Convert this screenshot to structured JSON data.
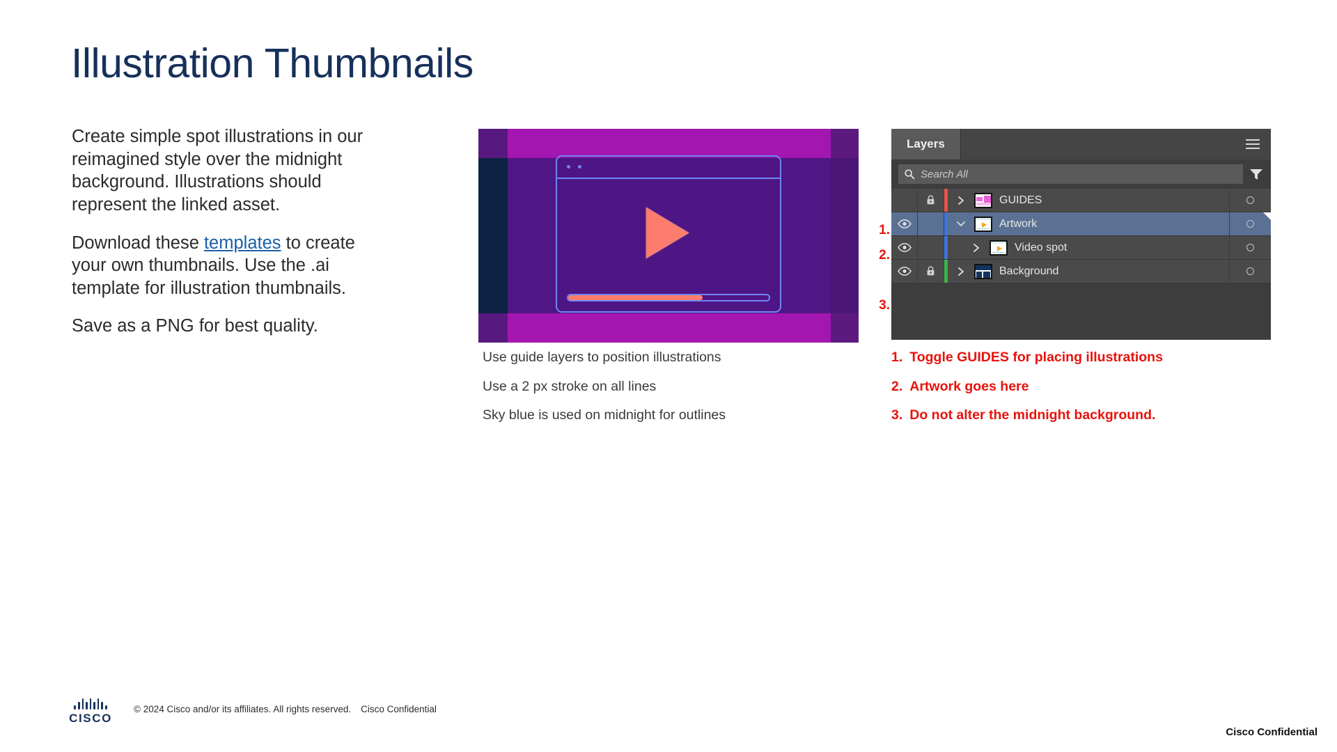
{
  "slide": {
    "title": "Illustration Thumbnails"
  },
  "copy": {
    "paragraph_1": "Create simple spot illustrations in our reimagined style over the midnight background. Illustrations should represent the linked asset.",
    "paragraph_2_before": "Download these ",
    "paragraph_2_link": "templates",
    "paragraph_2_after": " to create your own thumbnails. Use the .ai template for illustration thumbnails.",
    "paragraph_3": "Save as a PNG for best quality."
  },
  "thumbnail": {
    "alt": "video spot illustration on midnight background",
    "colors": {
      "magenta_band": "#a316b0",
      "purple_bg": "#4e1785",
      "navy_block": "#0e2243",
      "sky_blue_stroke": "#6f87f5",
      "coral": "#fc7d6e"
    },
    "captions": [
      "Use guide layers to position illustrations",
      "Use a 2 px stroke on all lines",
      "Sky blue is used on midnight for outlines"
    ]
  },
  "layers_panel": {
    "tab_label": "Layers",
    "menu_icon": "hamburger-icon",
    "search": {
      "placeholder": "Search All",
      "value": "",
      "icon": "search-icon",
      "filter_icon": "filter-icon"
    },
    "rows": [
      {
        "name": "GUIDES",
        "visible": false,
        "locked": true,
        "expanded": false,
        "selected": false,
        "indented": false,
        "color": "#e8544a",
        "thumb": "guides",
        "target_icon": "target-circle-icon"
      },
      {
        "name": "Artwork",
        "visible": true,
        "locked": false,
        "expanded": true,
        "selected": true,
        "indented": false,
        "color": "#3f74e0",
        "thumb": "artwork",
        "target_icon": "target-circle-icon"
      },
      {
        "name": "Video spot",
        "visible": true,
        "locked": false,
        "expanded": false,
        "selected": false,
        "indented": true,
        "color": "#3f74e0",
        "thumb": "artwork",
        "target_icon": "target-circle-icon"
      },
      {
        "name": "Background",
        "visible": true,
        "locked": true,
        "expanded": false,
        "selected": false,
        "indented": false,
        "color": "#3cb44a",
        "thumb": "background",
        "target_icon": "target-circle-icon"
      }
    ]
  },
  "callouts": {
    "numbers": [
      "1.",
      "2.",
      "3."
    ],
    "notes": [
      {
        "num": "1.",
        "text": "Toggle GUIDES for placing illustrations"
      },
      {
        "num": "2.",
        "text": "Artwork goes here"
      },
      {
        "num": "3.",
        "text": "Do not alter the midnight background."
      }
    ],
    "color": "#e8120c"
  },
  "footer": {
    "logo_word": "CISCO",
    "copyright": "© 2024  Cisco and/or its affiliates. All rights reserved.",
    "confidential": "Cisco Confidential",
    "corner_confidential": "Cisco Confidential"
  }
}
